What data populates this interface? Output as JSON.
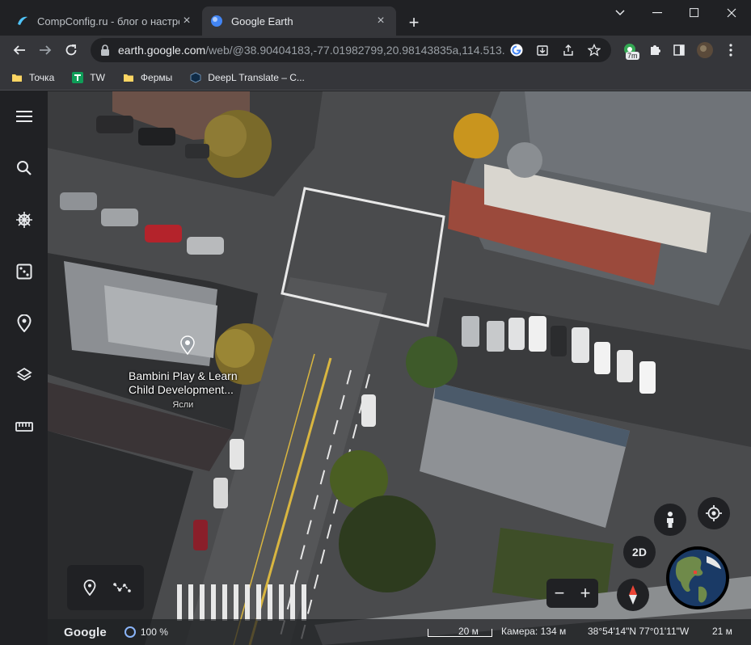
{
  "browser": {
    "tabs": [
      {
        "title": "CompConfig.ru - блог о настрой",
        "active": false
      },
      {
        "title": "Google Earth",
        "active": true
      }
    ],
    "address": {
      "host": "earth.google.com",
      "path": "/web/@38.90404183,-77.01982799,20.98143835a,114.513..."
    },
    "badge": "7m",
    "bookmarks": [
      {
        "label": "Точка",
        "icon": "folder-icon"
      },
      {
        "label": "TW",
        "icon": "tw-icon"
      },
      {
        "label": "Фермы",
        "icon": "folder-icon"
      },
      {
        "label": "DeepL Translate – C...",
        "icon": "deepl-icon"
      }
    ]
  },
  "map": {
    "place_label_line1": "Bambini Play & Learn",
    "place_label_line2": "Child Development...",
    "place_category": "Ясли",
    "view_mode_button": "2D"
  },
  "status": {
    "logo": "Google",
    "loading": "100 %",
    "scale": "20 м",
    "camera": "Камера: 134 м",
    "coordinates": "38°54'14\"N 77°01'11\"W",
    "altitude": "21 м"
  },
  "colors": {
    "accent": "#8ab4f8",
    "chrome_dark": "#202124",
    "chrome_toolbar": "#35363a"
  }
}
